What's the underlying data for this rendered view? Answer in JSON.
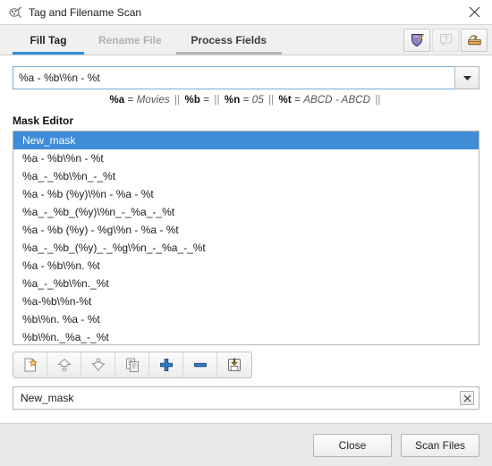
{
  "window": {
    "title": "Tag and Filename Scan",
    "app_icon": "app-icon",
    "close_icon": "close-icon"
  },
  "tabs": [
    {
      "label": "Fill Tag",
      "state": "active"
    },
    {
      "label": "Rename File",
      "state": "disabled"
    },
    {
      "label": "Process Fields",
      "state": "inactive"
    }
  ],
  "tab_tools": [
    {
      "name": "mask-shield-icon",
      "enabled": true
    },
    {
      "name": "comment-help-icon",
      "enabled": false
    },
    {
      "name": "archive-box-icon",
      "enabled": true
    }
  ],
  "mask_combo": {
    "value": "%a - %b\\%n - %t",
    "placeholder": "",
    "dropdown_icon": "chevron-down-icon"
  },
  "hint": {
    "items": [
      {
        "code": "%a",
        "value": "Movies"
      },
      {
        "code": "%b",
        "value": ""
      },
      {
        "code": "%n",
        "value": "05"
      },
      {
        "code": "%t",
        "value": "ABCD - ABCD"
      }
    ],
    "separator": "||",
    "equals": "="
  },
  "mask_editor": {
    "title": "Mask Editor",
    "selected_index": 0,
    "items": [
      "New_mask",
      "%a - %b\\%n - %t",
      "%a_-_%b\\%n_-_%t",
      "%a - %b (%y)\\%n - %a - %t",
      "%a_-_%b_(%y)\\%n_-_%a_-_%t",
      "%a - %b (%y) - %g\\%n - %a - %t",
      "%a_-_%b_(%y)_-_%g\\%n_-_%a_-_%t",
      "%a - %b\\%n. %t",
      "%a_-_%b\\%n._%t",
      "%a-%b\\%n-%t",
      "%b\\%n. %a - %t",
      "%b\\%n._%a_-_%t"
    ]
  },
  "mask_toolbar": [
    {
      "name": "new-mask-icon",
      "label": "New"
    },
    {
      "name": "move-up-icon",
      "label": "Move Up"
    },
    {
      "name": "move-down-icon",
      "label": "Move Down"
    },
    {
      "name": "duplicate-icon",
      "label": "Duplicate"
    },
    {
      "name": "add-icon",
      "label": "Add"
    },
    {
      "name": "remove-icon",
      "label": "Remove"
    },
    {
      "name": "save-icon",
      "label": "Save"
    }
  ],
  "name_field": {
    "value": "New_mask",
    "clear_icon": "clear-icon"
  },
  "footer": {
    "close_label": "Close",
    "scan_label": "Scan Files"
  },
  "colors": {
    "accent": "#2f90df",
    "selection": "#3f8cd8",
    "footer_bg": "#e9e9e9",
    "tab_bg": "#f0f0f0"
  }
}
